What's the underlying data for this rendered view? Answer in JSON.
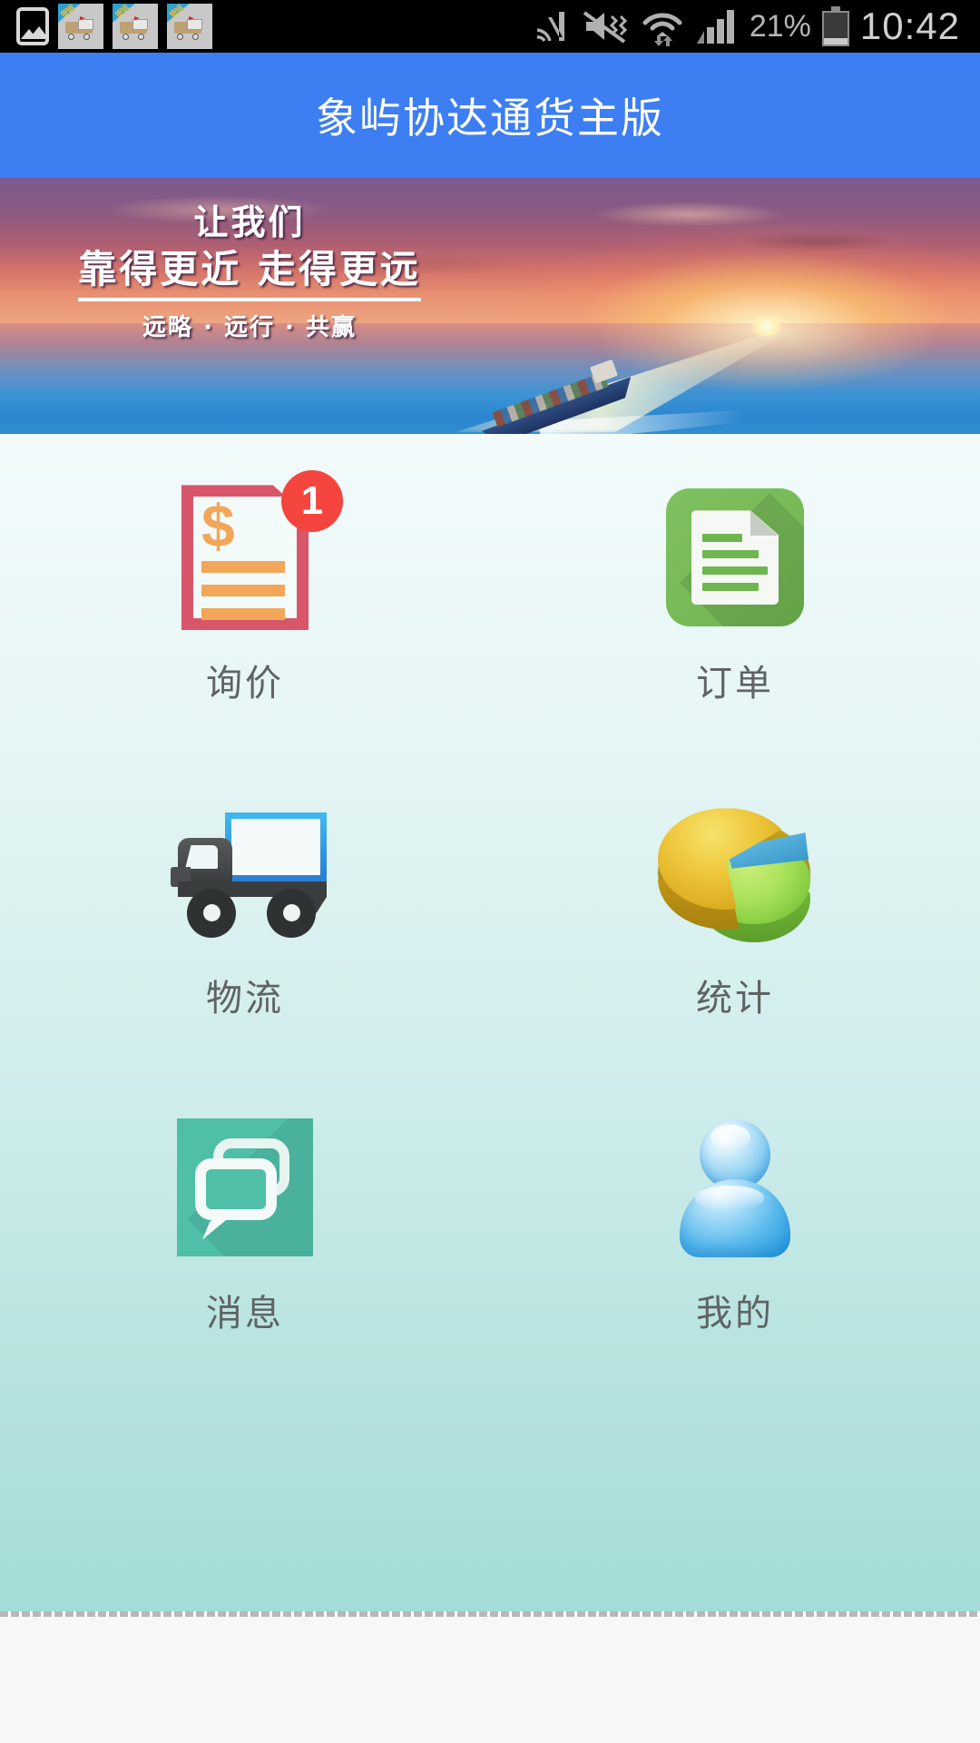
{
  "status_bar": {
    "left_icons": [
      {
        "name": "gallery-icon",
        "label": "gallery"
      },
      {
        "name": "truck-app-notification-icon",
        "label": "app"
      },
      {
        "name": "truck-app-notification-icon",
        "label": "app"
      },
      {
        "name": "truck-app-notification-icon",
        "label": "app"
      }
    ],
    "right_icons": [
      {
        "name": "nfc-icon",
        "label": "NFC"
      },
      {
        "name": "mute-vibrate-icon",
        "label": "mute"
      },
      {
        "name": "wifi-icon",
        "label": "wifi"
      },
      {
        "name": "cellular-signal-icon",
        "label": "signal"
      }
    ],
    "battery_percent": "21%",
    "battery_level": 21,
    "clock": "10:42"
  },
  "header": {
    "title": "象屿协达通货主版",
    "background_color": "#3d7ef2",
    "text_color": "#ffffff"
  },
  "banner": {
    "line1": "让我们",
    "line2": "靠得更近 走得更远",
    "line3": "远略 · 远行 · 共赢",
    "scene": "container-ship-sunset-sea"
  },
  "grid": {
    "items": [
      {
        "id": "inquiry",
        "label": "询价",
        "icon": "price-inquiry-document-icon",
        "badge": "1",
        "badge_color": "#f4453f",
        "accent_color": "#d8566a"
      },
      {
        "id": "orders",
        "label": "订单",
        "icon": "order-document-icon",
        "badge": null,
        "accent_color": "#6fb550"
      },
      {
        "id": "logistics",
        "label": "物流",
        "icon": "delivery-truck-icon",
        "badge": null,
        "accent_color": "#2b7fd4"
      },
      {
        "id": "statistics",
        "label": "统计",
        "icon": "pie-chart-icon",
        "badge": null,
        "accent_color": "#edc53a"
      },
      {
        "id": "messages",
        "label": "消息",
        "icon": "chat-bubbles-icon",
        "badge": null,
        "accent_color": "#4fbfa8"
      },
      {
        "id": "profile",
        "label": "我的",
        "icon": "user-avatar-icon",
        "badge": null,
        "accent_color": "#2e9ee2"
      }
    ],
    "label_color": "#5f6363",
    "background_gradient": [
      "#f3fbfb",
      "#a4dcd8"
    ]
  }
}
